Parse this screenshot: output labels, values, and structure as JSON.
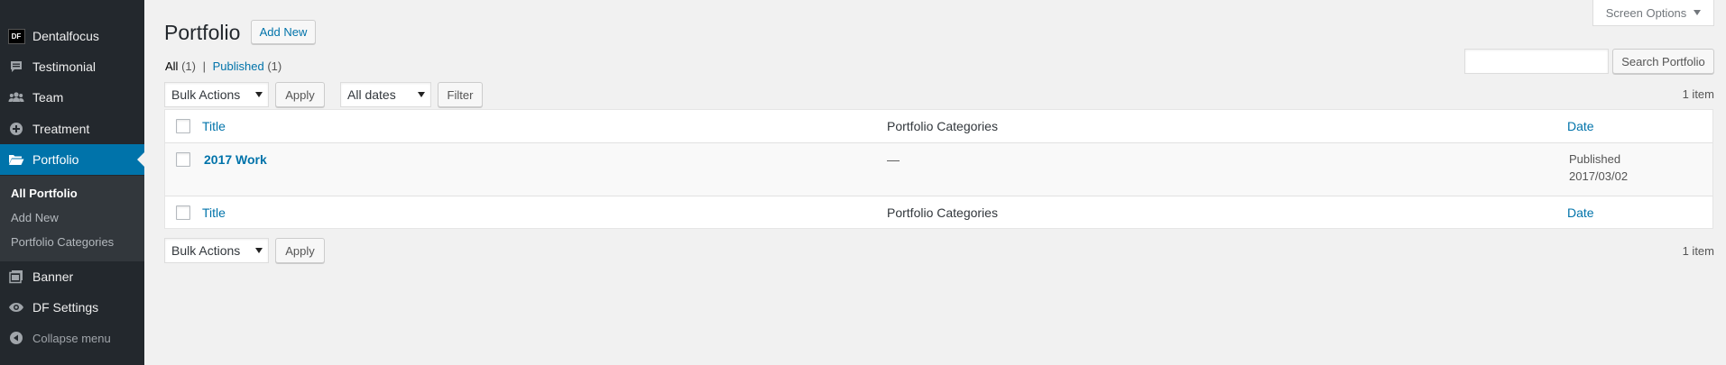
{
  "sidebar": {
    "items": [
      {
        "label": "Dentalfocus",
        "icon": "df-logo-icon"
      },
      {
        "label": "Testimonial",
        "icon": "comment-icon"
      },
      {
        "label": "Team",
        "icon": "groups-icon"
      },
      {
        "label": "Treatment",
        "icon": "plus-circle-icon"
      },
      {
        "label": "Portfolio",
        "icon": "folder-open-icon"
      },
      {
        "label": "Banner",
        "icon": "gallery-icon"
      },
      {
        "label": "DF Settings",
        "icon": "visibility-icon"
      }
    ],
    "df_badge": "DF",
    "submenu": [
      "All Portfolio",
      "Add New",
      "Portfolio Categories"
    ],
    "collapse_label": "Collapse menu"
  },
  "header": {
    "title": "Portfolio",
    "add_new": "Add New",
    "screen_options": "Screen Options"
  },
  "filters": {
    "all_label": "All",
    "all_count": "(1)",
    "separator": "|",
    "published_label": "Published",
    "published_count": "(1)"
  },
  "search": {
    "button": "Search Portfolio",
    "value": ""
  },
  "top_nav": {
    "bulk_actions": "Bulk Actions",
    "apply": "Apply",
    "dates": "All dates",
    "filter": "Filter",
    "items_count": "1 item"
  },
  "table": {
    "columns": [
      "Title",
      "Portfolio Categories",
      "Date"
    ],
    "rows": [
      {
        "title": "2017 Work",
        "categories": "—",
        "status": "Published",
        "date": "2017/03/02"
      }
    ]
  },
  "bottom_nav": {
    "bulk_actions": "Bulk Actions",
    "apply": "Apply",
    "items_count": "1 item"
  },
  "colors": {
    "accent": "#0073aa",
    "sidebar_bg": "#23282d",
    "submenu_bg": "#32373c"
  }
}
